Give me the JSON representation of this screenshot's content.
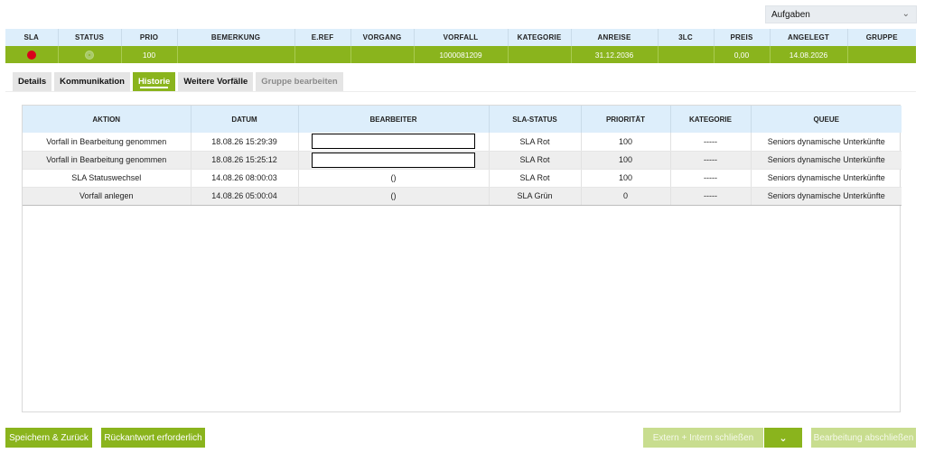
{
  "tasks_dropdown": {
    "label": "Aufgaben"
  },
  "case_table": {
    "headers": [
      "SLA",
      "STATUS",
      "PRIO",
      "BEMERKUNG",
      "E.REF",
      "VORGANG",
      "VORFALL",
      "KATEGORIE",
      "ANREISE",
      "3LC",
      "PREIS",
      "ANGELEGT",
      "GRUPPE"
    ],
    "row": {
      "prio": "100",
      "bemerkung": "",
      "eref": "",
      "vorgang": "",
      "vorfall": "1000081209",
      "kategorie": "",
      "anreise": "31.12.2036",
      "lc3": "",
      "preis": "0,00",
      "angelegt": "14.08.2026",
      "gruppe": ""
    },
    "sla_color": "#d9001b",
    "row_color": "#8ab41d"
  },
  "tabs": [
    {
      "label": "Details"
    },
    {
      "label": "Kommunikation"
    },
    {
      "label": "Historie"
    },
    {
      "label": "Weitere Vorfälle"
    },
    {
      "label": "Gruppe bearbeiten"
    }
  ],
  "history": {
    "headers": [
      "AKTION",
      "DATUM",
      "BEARBEITER",
      "SLA-STATUS",
      "PRIORITÄT",
      "KATEGORIE",
      "QUEUE"
    ],
    "rows": [
      {
        "aktion": "Vorfall in Bearbeitung genommen",
        "datum": "18.08.26 15:29:39",
        "bearbeiter": "",
        "sla_status": "SLA Rot",
        "prioritaet": "100",
        "kategorie": "-----",
        "queue": "Seniors dynamische Unterkünfte"
      },
      {
        "aktion": "Vorfall in Bearbeitung genommen",
        "datum": "18.08.26 15:25:12",
        "bearbeiter": "",
        "sla_status": "SLA Rot",
        "prioritaet": "100",
        "kategorie": "-----",
        "queue": "Seniors dynamische Unterkünfte"
      },
      {
        "aktion": "SLA Statuswechsel",
        "datum": "14.08.26 08:00:03",
        "bearbeiter": "()",
        "sla_status": "SLA Rot",
        "prioritaet": "100",
        "kategorie": "-----",
        "queue": "Seniors dynamische Unterkünfte"
      },
      {
        "aktion": "Vorfall anlegen",
        "datum": "14.08.26 05:00:04",
        "bearbeiter": "()",
        "sla_status": "SLA Grün",
        "prioritaet": "0",
        "kategorie": "-----",
        "queue": "Seniors dynamische Unterkünfte"
      }
    ]
  },
  "footer": {
    "save_back": "Speichern & Zurück",
    "reply_required": "Rückantwort erforderlich",
    "close_ext_int": "Extern + Intern schließen",
    "finish": "Bearbeitung abschließen"
  },
  "accent_color": "#8ab41d"
}
